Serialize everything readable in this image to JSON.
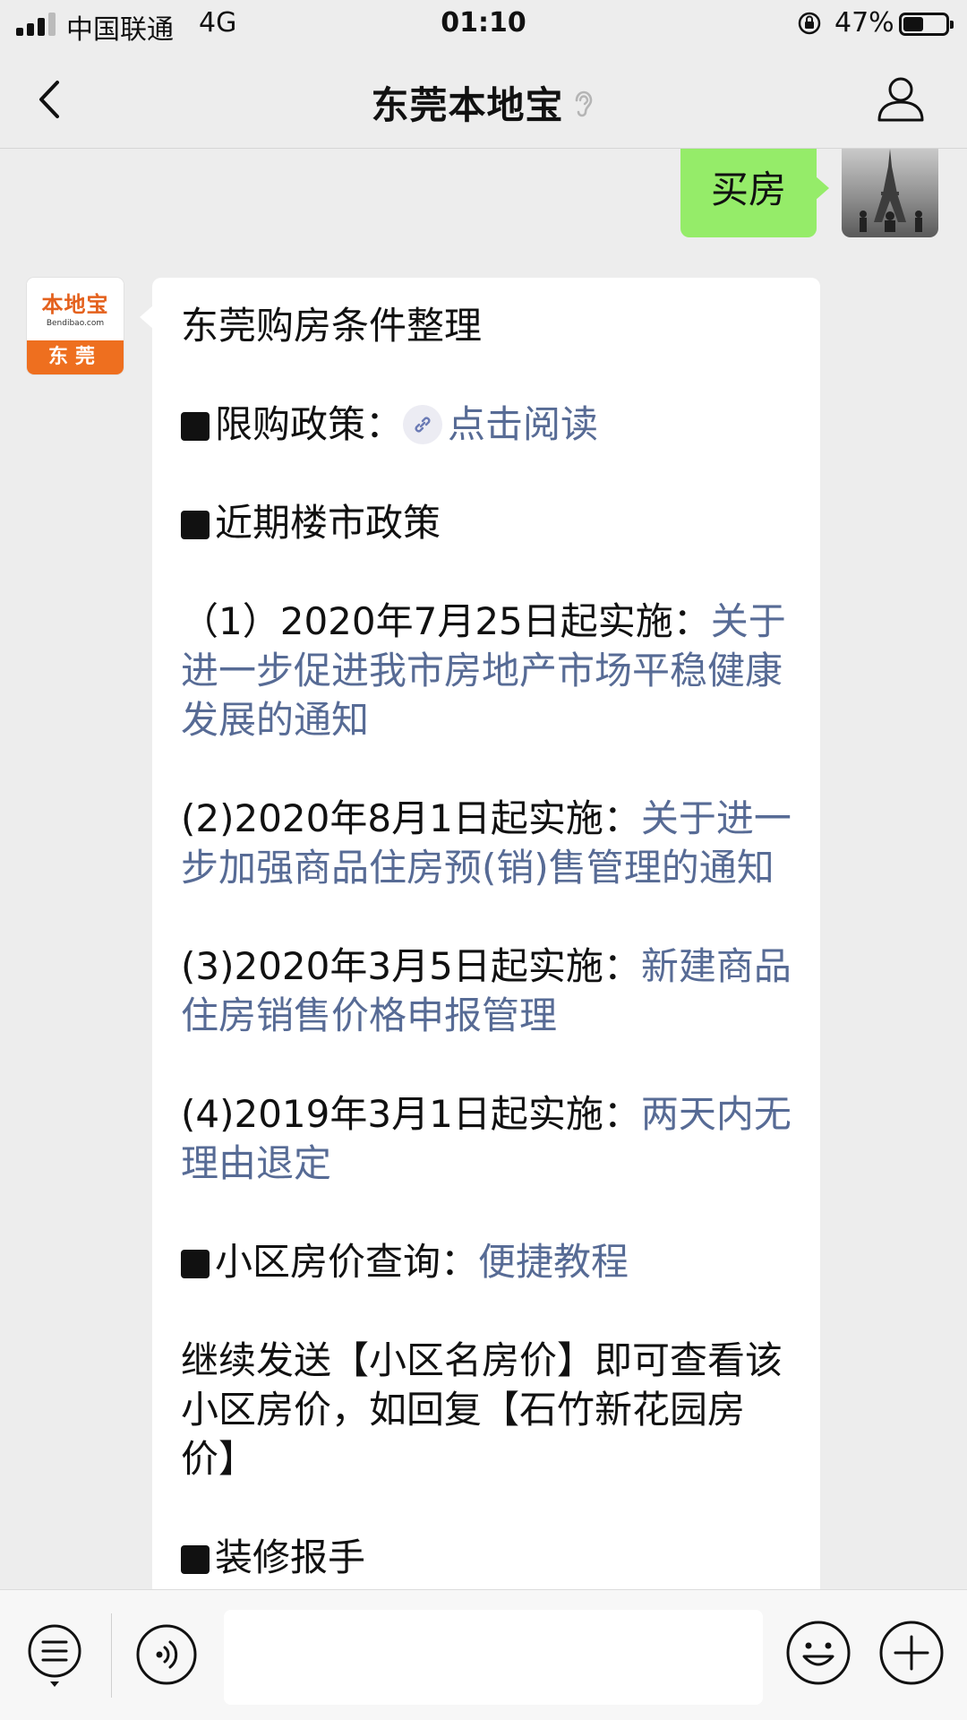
{
  "status_bar": {
    "carrier": "中国联通",
    "network": "4G",
    "time": "01:10",
    "battery_percent": "47%",
    "battery_level": 0.47
  },
  "nav": {
    "title": "东莞本地宝",
    "back_icon": "chevron-left-icon",
    "ear_icon": "ear-icon",
    "profile_icon": "profile-icon"
  },
  "chat": {
    "user_message": "买房",
    "bot_avatar": {
      "name": "本地宝",
      "domain": "Bendibao.com",
      "city": "东莞"
    },
    "bot_message": {
      "title": "东莞购房条件整理",
      "purchase_policy_label": "限购政策：",
      "purchase_policy_link": "点击阅读",
      "recent_policy_heading": "近期楼市政策",
      "items": [
        {
          "prefix": "（1）2020年7月25日起实施：",
          "link": "关于进一步促进我市房地产市场平稳健康发展的通知"
        },
        {
          "prefix": "(2)2020年8月1日起实施：",
          "link": "关于进一步加强商品住房预(销)售管理的通知"
        },
        {
          "prefix": "(3)2020年3月5日起实施：",
          "link": "新建商品住房销售价格申报管理"
        },
        {
          "prefix": "(4)2019年3月1日起实施：",
          "link": "两天内无理由退定"
        }
      ],
      "price_query_label": "小区房价查询：",
      "price_query_link": "便捷教程",
      "instruction": "继续发送【小区名房价】即可查看该小区房价，如回复【石竹新花园房价】",
      "partial_heading": "装修报手"
    }
  },
  "input_bar": {
    "menu_icon": "menu-icon",
    "voice_icon": "voice-icon",
    "emoji_icon": "emoji-icon",
    "plus_icon": "plus-icon",
    "input_value": ""
  },
  "colors": {
    "background": "#ededed",
    "user_bubble": "#95ec69",
    "link": "#576b95",
    "brand_orange": "#ee6f1f"
  }
}
